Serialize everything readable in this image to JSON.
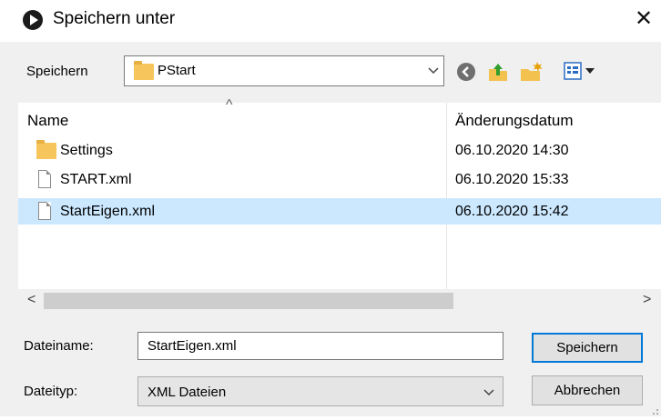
{
  "window": {
    "title": "Speichern unter",
    "close_glyph": "✕"
  },
  "location": {
    "label": "Speichern",
    "value": "PStart",
    "toolbar_icons": [
      "back-icon",
      "up-folder-icon",
      "new-folder-icon",
      "view-menu-icon"
    ]
  },
  "list": {
    "columns": {
      "name": "Name",
      "date": "Änderungsdatum",
      "sort_glyph": "^"
    },
    "rows": [
      {
        "name": "Settings",
        "date": "06.10.2020 14:30",
        "icon": "folder-icon"
      },
      {
        "name": "START.xml",
        "date": "06.10.2020 15:33",
        "icon": "file-icon"
      },
      {
        "name": "StartEigen.xml",
        "date": "06.10.2020 15:42",
        "icon": "file-icon",
        "selected": true
      }
    ]
  },
  "scroll": {
    "left_glyph": "<",
    "right_glyph": ">"
  },
  "filename": {
    "label": "Dateiname:",
    "value": "StartEigen.xml"
  },
  "filetype": {
    "label": "Dateityp:",
    "value": "XML Dateien"
  },
  "buttons": {
    "save": "Speichern",
    "cancel": "Abbrechen"
  },
  "colors": {
    "selection": "#cce8ff",
    "default_button_border": "#0078d7",
    "folder": "#f6c55c"
  }
}
